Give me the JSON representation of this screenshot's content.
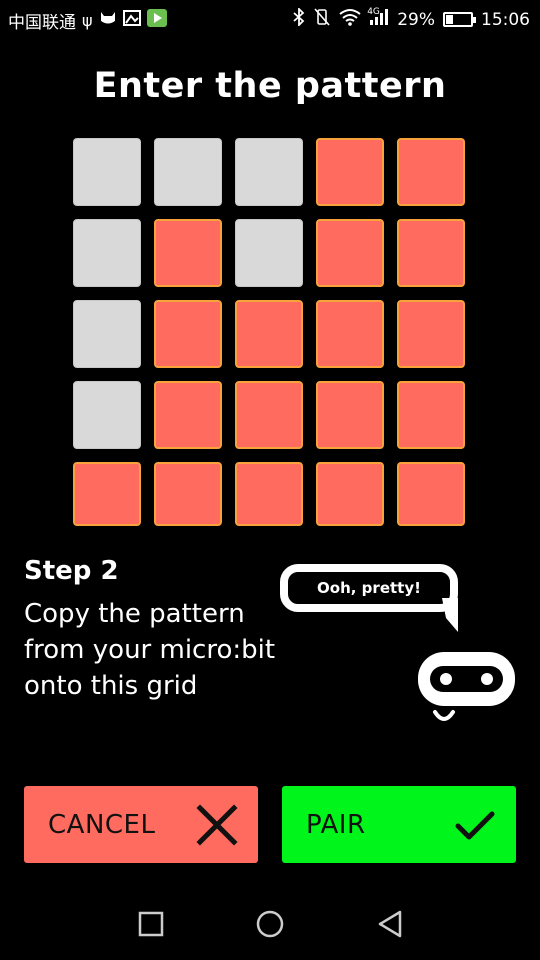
{
  "status_bar": {
    "carrier": "中国联通",
    "left_icons": [
      "usb-icon",
      "cat-icon",
      "gallery-icon",
      "play-store-icon"
    ],
    "right_icons": [
      "bluetooth-icon",
      "vibrate-icon",
      "wifi-icon",
      "signal-icon",
      "battery-icon"
    ],
    "network_type": "4G",
    "battery_percent": "29%",
    "battery_level": 0.29,
    "time": "15:06"
  },
  "title": "Enter the pattern",
  "pattern_grid": {
    "rows": 5,
    "cols": 5,
    "cells": [
      [
        false,
        false,
        false,
        true,
        true
      ],
      [
        false,
        true,
        false,
        true,
        true
      ],
      [
        false,
        true,
        true,
        true,
        true
      ],
      [
        false,
        true,
        true,
        true,
        true
      ],
      [
        true,
        true,
        true,
        true,
        true
      ]
    ],
    "colors": {
      "on": "#ff6b5e",
      "on_border": "#f7a23b",
      "off": "#d9d9d9"
    }
  },
  "step": {
    "title": "Step 2",
    "text": "Copy the pattern from your micro:bit onto this grid"
  },
  "mascot": {
    "speech": "Ooh, pretty!"
  },
  "buttons": {
    "cancel": {
      "label": "CANCEL",
      "icon": "close-icon",
      "color": "#ff6b5e"
    },
    "pair": {
      "label": "PAIR",
      "icon": "check-icon",
      "color": "#00f51a"
    }
  },
  "nav_bar": {
    "icons": [
      "recent-apps-icon",
      "home-icon",
      "back-icon"
    ]
  }
}
